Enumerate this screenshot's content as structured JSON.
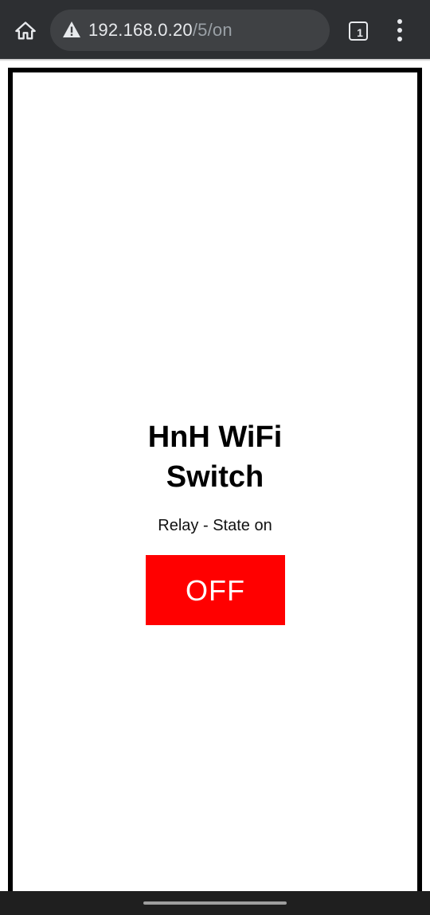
{
  "browser": {
    "url_host": "192.168.0.20",
    "url_path": "/5/on",
    "tab_count": "1",
    "icons": {
      "home": "home-icon",
      "security": "warning-icon",
      "tabs": "tab-switcher-icon",
      "menu": "more-vert-icon"
    },
    "toolbar_color": "#2d2f32",
    "omnibox_color": "#3f4144"
  },
  "page": {
    "title": "HnH WiFi Switch",
    "state_text": "Relay - State on",
    "toggle_label": "OFF",
    "toggle_color": "#ff0000",
    "frame_color": "#000000"
  }
}
